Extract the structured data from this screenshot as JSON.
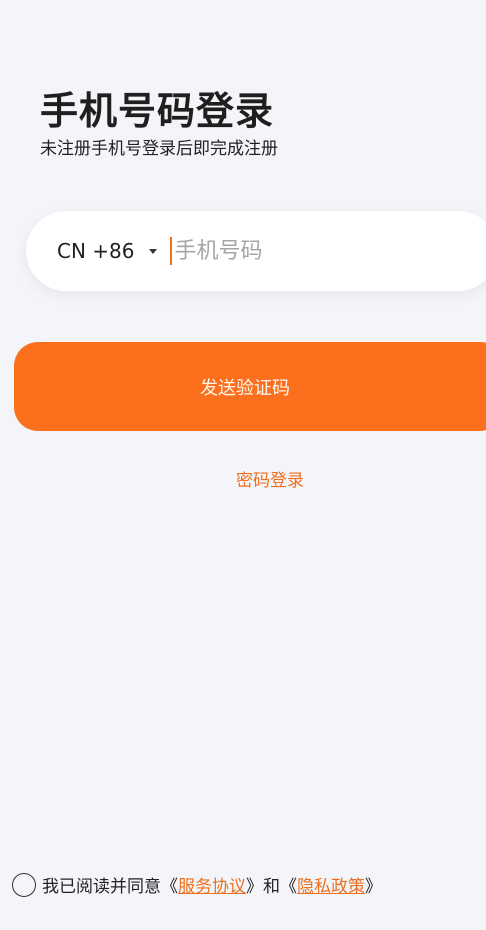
{
  "header": {
    "title": "手机号码登录",
    "subtitle": "未注册手机号登录后即完成注册"
  },
  "phone": {
    "country_code": "CN +86",
    "placeholder": "手机号码"
  },
  "actions": {
    "send_code_label": "发送验证码",
    "password_login_label": "密码登录"
  },
  "agreement": {
    "prefix": "我已阅读并同意",
    "open_bracket_1": "《",
    "service_label": "服务协议",
    "close_bracket_1": "》",
    "and": "和",
    "open_bracket_2": "《",
    "privacy_label": "隐私政策",
    "close_bracket_2": "》"
  },
  "colors": {
    "accent": "#fb6f1d",
    "link": "#ec7020",
    "background": "#f4f5f9"
  },
  "icons": {
    "dropdown": "caret-down-icon",
    "checkbox": "radio-circle-icon"
  }
}
